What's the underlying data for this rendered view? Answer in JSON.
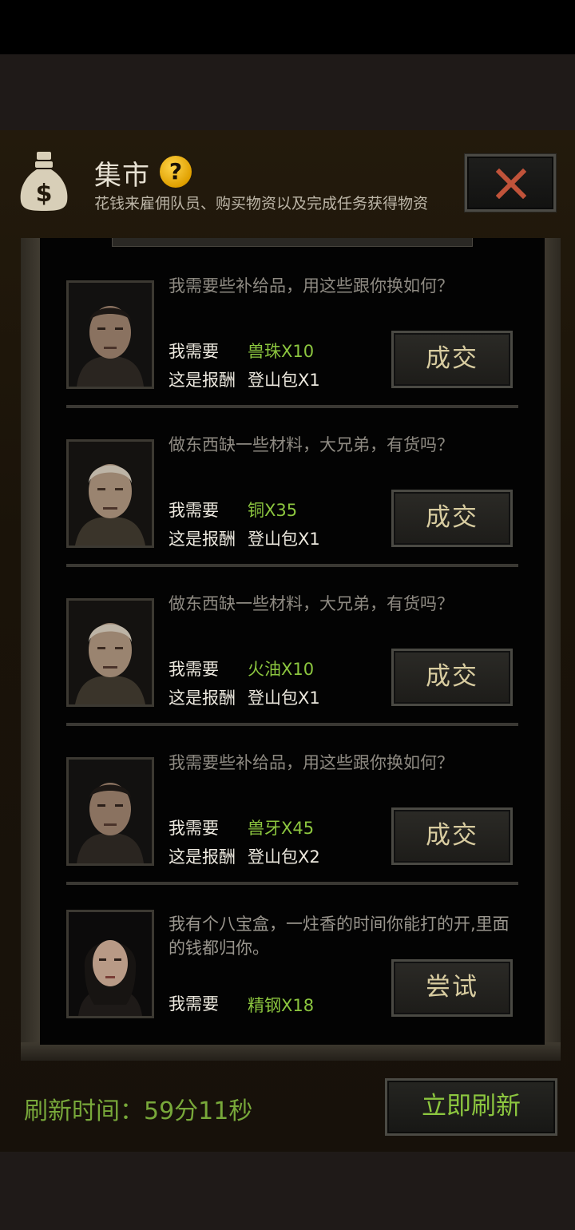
{
  "header": {
    "title": "集市",
    "subtitle": "花钱来雇佣队员、购买物资以及完成任务获得物资",
    "help_glyph": "?",
    "icon": "money-bag-icon",
    "close_icon": "close-icon"
  },
  "labels": {
    "need": "我需要",
    "reward": "这是报酬"
  },
  "items": [
    {
      "portrait": "man-portrait",
      "dialog": "我需要些补给品，用这些跟你换如何？",
      "need": "兽珠X10",
      "reward": "登山包X1",
      "action": "成交"
    },
    {
      "portrait": "old-man-portrait",
      "dialog": "做东西缺一些材料，大兄弟，有货吗？",
      "need": "铜X35",
      "reward": "登山包X1",
      "action": "成交"
    },
    {
      "portrait": "old-man-portrait",
      "dialog": "做东西缺一些材料，大兄弟，有货吗？",
      "need": "火油X10",
      "reward": "登山包X1",
      "action": "成交"
    },
    {
      "portrait": "man-portrait",
      "dialog": "我需要些补给品，用这些跟你换如何？",
      "need": "兽牙X45",
      "reward": "登山包X2",
      "action": "成交"
    },
    {
      "portrait": "woman-portrait",
      "dialog": "我有个八宝盒，一炷香的时间你能打的开,里面的钱都归你。",
      "need": "精钢X18",
      "action": "尝试"
    }
  ],
  "footer": {
    "refresh_time": "刷新时间：59分11秒",
    "refresh_button": "立即刷新"
  },
  "colors": {
    "need_green": "#8cc63f",
    "refresh_green": "#78a83a",
    "button_text": "#d8cca0",
    "close_red": "#c0533a"
  }
}
